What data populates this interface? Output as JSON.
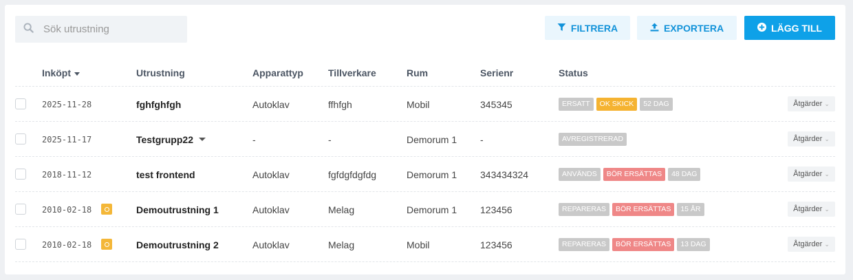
{
  "search": {
    "placeholder": "Sök utrustning",
    "value": ""
  },
  "toolbar": {
    "filter_label": "FILTRERA",
    "export_label": "EXPORTERA",
    "add_label": "LÄGG TILL"
  },
  "columns": {
    "purchased": "Inköpt",
    "equipment": "Utrustning",
    "device_type": "Apparattyp",
    "manufacturer": "Tillverkare",
    "room": "Rum",
    "serial": "Serienr",
    "status": "Status"
  },
  "colors": {
    "primary": "#0ea1e8",
    "badge_grey": "#c9c9c9",
    "badge_yellow": "#f5b331",
    "badge_red": "#ef8787",
    "marker": "#f4b738"
  },
  "rows": [
    {
      "date": "2025-11-28",
      "name": "fghfghfgh",
      "type": "Autoklav",
      "manufacturer": "ffhfgh",
      "room": "Mobil",
      "serial": "345345",
      "marker": false,
      "dropdown": false,
      "badges": [
        {
          "text": "ERSATT",
          "color": "grey"
        },
        {
          "text": "OK SKICK",
          "color": "yellow"
        },
        {
          "text": "52 DAG",
          "color": "grey"
        }
      ],
      "actions": "Åtgärder"
    },
    {
      "date": "2025-11-17",
      "name": "Testgrupp22",
      "type": "-",
      "manufacturer": "-",
      "room": "Demorum 1",
      "serial": "-",
      "marker": false,
      "dropdown": true,
      "badges": [
        {
          "text": "AVREGISTRERAD",
          "color": "grey"
        }
      ],
      "actions": "Åtgärder"
    },
    {
      "date": "2018-11-12",
      "name": "test frontend",
      "type": "Autoklav",
      "manufacturer": "fgfdgfdgfdg",
      "room": "Demorum 1",
      "serial": "343434324",
      "marker": false,
      "dropdown": false,
      "badges": [
        {
          "text": "ANVÄNDS",
          "color": "grey"
        },
        {
          "text": "BÖR ERSÄTTAS",
          "color": "red"
        },
        {
          "text": "48 DAG",
          "color": "grey"
        }
      ],
      "actions": "Åtgärder"
    },
    {
      "date": "2010-02-18",
      "name": "Demoutrustning 1",
      "type": "Autoklav",
      "manufacturer": "Melag",
      "room": "Demorum 1",
      "serial": "123456",
      "marker": true,
      "dropdown": false,
      "badges": [
        {
          "text": "REPARERAS",
          "color": "grey"
        },
        {
          "text": "BÖR ERSÄTTAS",
          "color": "red"
        },
        {
          "text": "15 ÅR",
          "color": "grey"
        }
      ],
      "actions": "Åtgärder"
    },
    {
      "date": "2010-02-18",
      "name": "Demoutrustning 2",
      "type": "Autoklav",
      "manufacturer": "Melag",
      "room": "Mobil",
      "serial": "123456",
      "marker": true,
      "dropdown": false,
      "badges": [
        {
          "text": "REPARERAS",
          "color": "grey"
        },
        {
          "text": "BÖR ERSÄTTAS",
          "color": "red"
        },
        {
          "text": "13 DAG",
          "color": "grey"
        }
      ],
      "actions": "Åtgärder"
    }
  ]
}
